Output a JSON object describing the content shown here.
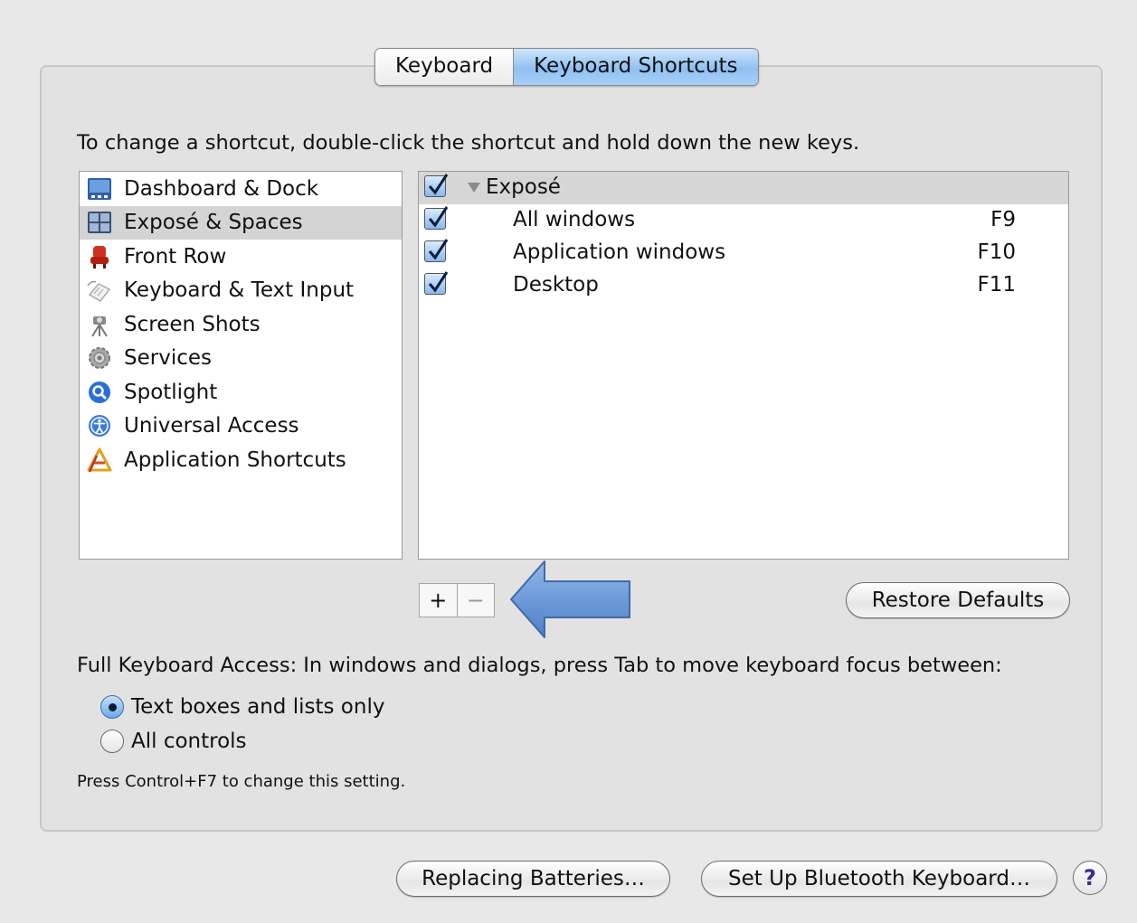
{
  "tabs": [
    {
      "label": "Keyboard",
      "active": false
    },
    {
      "label": "Keyboard Shortcuts",
      "active": true
    }
  ],
  "instruction": "To change a shortcut, double-click the shortcut and hold down the new keys.",
  "categories": [
    {
      "label": "Dashboard & Dock",
      "icon": "dashboard-dock-icon",
      "selected": false
    },
    {
      "label": "Exposé & Spaces",
      "icon": "expose-spaces-icon",
      "selected": true
    },
    {
      "label": "Front Row",
      "icon": "front-row-icon",
      "selected": false
    },
    {
      "label": "Keyboard & Text Input",
      "icon": "keyboard-text-input-icon",
      "selected": false
    },
    {
      "label": "Screen Shots",
      "icon": "screen-shots-icon",
      "selected": false
    },
    {
      "label": "Services",
      "icon": "services-icon",
      "selected": false
    },
    {
      "label": "Spotlight",
      "icon": "spotlight-icon",
      "selected": false
    },
    {
      "label": "Universal Access",
      "icon": "universal-access-icon",
      "selected": false
    },
    {
      "label": "Application Shortcuts",
      "icon": "application-shortcuts-icon",
      "selected": false
    }
  ],
  "shortcuts": {
    "group": {
      "label": "Exposé",
      "checked": true,
      "expanded": true
    },
    "items": [
      {
        "label": "All windows",
        "key": "F9",
        "checked": true
      },
      {
        "label": "Application windows",
        "key": "F10",
        "checked": true
      },
      {
        "label": "Desktop",
        "key": "F11",
        "checked": true
      }
    ]
  },
  "controls": {
    "add_label": "+",
    "remove_label": "−",
    "restore_defaults": "Restore Defaults"
  },
  "full_keyboard_access": {
    "label": "Full Keyboard Access: In windows and dialogs, press Tab to move keyboard focus between:",
    "options": [
      {
        "label": "Text boxes and lists only",
        "selected": true
      },
      {
        "label": "All controls",
        "selected": false
      }
    ],
    "note": "Press Control+F7 to change this setting."
  },
  "footer": {
    "replacing_batteries": "Replacing Batteries…",
    "bluetooth_setup": "Set Up Bluetooth Keyboard…",
    "help": "?"
  },
  "colors": {
    "annotation_arrow": "#5b8fd4",
    "selection_blue": "#8fc0f3"
  }
}
